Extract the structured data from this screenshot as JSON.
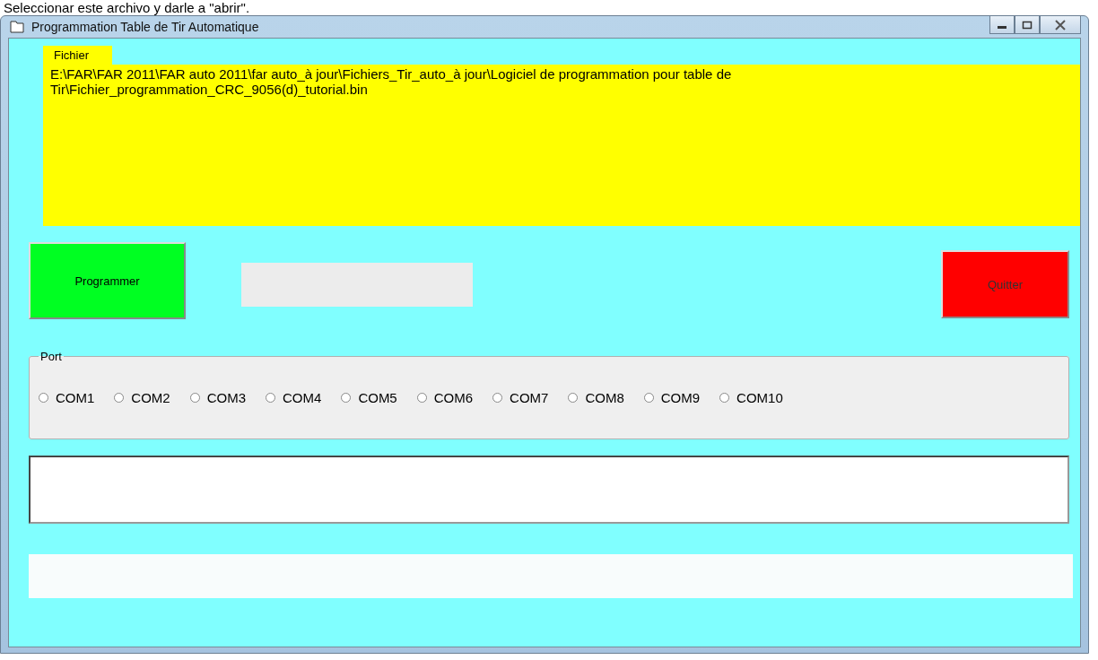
{
  "caption": "Seleccionar este archivo y darle a \"abrir\".",
  "window": {
    "title": "Programmation Table de Tir Automatique"
  },
  "file_section": {
    "label": "Fichier",
    "path": "E:\\FAR\\FAR 2011\\FAR auto 2011\\far auto_à jour\\Fichiers_Tir_auto_à jour\\Logiciel de programmation pour table de Tir\\Fichier_programmation_CRC_9056(d)_tutorial.bin"
  },
  "buttons": {
    "program": "Programmer",
    "quit": "Quitter"
  },
  "port": {
    "label": "Port",
    "options": [
      {
        "label": "COM1",
        "selected": false
      },
      {
        "label": "COM2",
        "selected": false
      },
      {
        "label": "COM3",
        "selected": false
      },
      {
        "label": "COM4",
        "selected": false
      },
      {
        "label": "COM5",
        "selected": false
      },
      {
        "label": "COM6",
        "selected": false
      },
      {
        "label": "COM7",
        "selected": false
      },
      {
        "label": "COM8",
        "selected": false
      },
      {
        "label": "COM9",
        "selected": false
      },
      {
        "label": "COM10",
        "selected": false
      }
    ]
  }
}
